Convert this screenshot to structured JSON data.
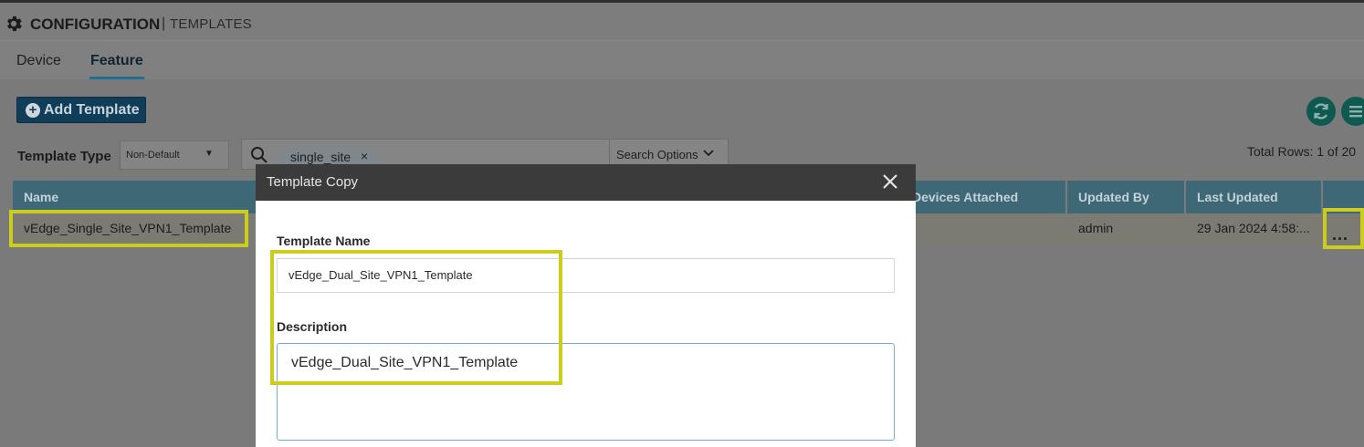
{
  "header": {
    "title": "CONFIGURATION",
    "separator": "|",
    "subtitle": "TEMPLATES",
    "icon": "gear-icon"
  },
  "tabs": [
    {
      "label": "Device",
      "active": false
    },
    {
      "label": "Feature",
      "active": true
    }
  ],
  "toolbar": {
    "add_template_label": "Add Template",
    "refresh_icon": "refresh-icon",
    "menu_icon": "menu-icon"
  },
  "filters": {
    "template_type_label": "Template Type",
    "template_type_value": "Non-Default",
    "search_chip": "single_site",
    "search_options_label": "Search Options",
    "total_rows": "Total Rows: 1 of 20"
  },
  "table": {
    "columns": [
      "Name",
      "Devices Attached",
      "Updated By",
      "Last Updated"
    ],
    "rows": [
      {
        "name": "vEdge_Single_Site_VPN1_Template",
        "updated_by": "admin",
        "last_updated": "29 Jan 2024 4:58:...",
        "actions": "..."
      }
    ]
  },
  "modal": {
    "title": "Template Copy",
    "template_name_label": "Template Name",
    "template_name_value": "vEdge_Dual_Site_VPN1_Template",
    "description_label": "Description",
    "description_value": "vEdge_Dual_Site_VPN1_Template"
  },
  "colors": {
    "highlight": "#cccc1c",
    "table_header": "#3f6877",
    "primary_button": "#0f3d5a",
    "icon_button": "#0e5a50",
    "modal_header": "#3b3b3b"
  }
}
